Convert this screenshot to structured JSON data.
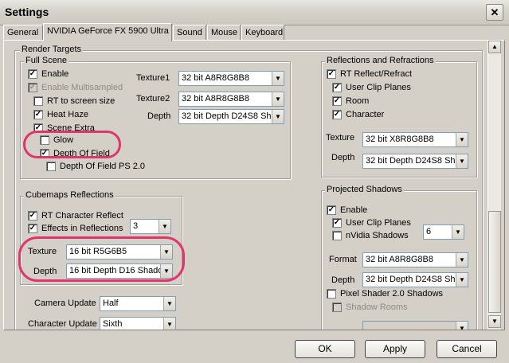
{
  "window": {
    "title": "Settings",
    "close_glyph": "✕"
  },
  "tabs": [
    "General",
    "NVIDIA GeForce FX 5900 Ultra",
    "Sound",
    "Mouse",
    "Keyboard"
  ],
  "render_targets": {
    "title": "Render Targets",
    "full_scene": {
      "title": "Full Scene",
      "checks": [
        {
          "label": "Enable",
          "checked": true,
          "enabled": true
        },
        {
          "label": "Enable Multisampled",
          "checked": true,
          "enabled": false
        },
        {
          "label": "RT to screen size",
          "checked": false,
          "enabled": true
        },
        {
          "label": "Heat Haze",
          "checked": true,
          "enabled": true
        },
        {
          "label": "Scene Extra",
          "checked": true,
          "enabled": true
        },
        {
          "label": "Glow",
          "checked": false,
          "enabled": true
        },
        {
          "label": "Depth Of Field",
          "checked": true,
          "enabled": true
        },
        {
          "label": "Depth Of Field PS 2.0",
          "checked": false,
          "enabled": true
        }
      ],
      "texture1_label": "Texture1",
      "texture1_value": "32 bit A8R8G8B8",
      "texture2_label": "Texture2",
      "texture2_value": "32 bit A8R8G8B8",
      "depth_label": "Depth",
      "depth_value": "32 bit Depth D24S8 Sh"
    },
    "reflections": {
      "title": "Reflections and Refractions",
      "checks": [
        {
          "label": "RT Reflect/Refract",
          "checked": true
        },
        {
          "label": "User Clip Planes",
          "checked": true
        },
        {
          "label": "Room",
          "checked": true
        },
        {
          "label": "Character",
          "checked": true
        }
      ],
      "texture_label": "Texture",
      "texture_value": "32 bit X8R8G8B8",
      "depth_label": "Depth",
      "depth_value": "32 bit Depth D24S8 Sh"
    },
    "cubemaps": {
      "title": "Cubemaps Reflections",
      "rt_character_reflect": "RT Character Reflect",
      "effects_in_reflections": "Effects in Reflections",
      "effects_count": "3",
      "texture_label": "Texture",
      "texture_value": "16 bit R5G6B5",
      "depth_label": "Depth",
      "depth_value": "16 bit Depth D16 Shado"
    },
    "camera_update_label": "Camera Update",
    "camera_update_value": "Half",
    "character_update_label": "Character Update",
    "character_update_value": "Sixth",
    "projected_shadows": {
      "title": "Projected Shadows",
      "enable": "Enable",
      "user_clip_planes": "User Clip Planes",
      "nvidia_shadows": "nVidia Shadows",
      "nvidia_count": "6",
      "format_label": "Format",
      "format_value": "32 bit A8R8G8B8",
      "depth_label": "Depth",
      "depth_value": "32 bit Depth D24S8 Sh",
      "pixel_shader_shadows": "Pixel Shader 2.0 Shadows",
      "shadow_rooms": "Shadow Rooms"
    }
  },
  "buttons": {
    "ok": "OK",
    "apply": "Apply",
    "cancel": "Cancel"
  },
  "colors": {
    "annotation": "#e0356a",
    "dialog_bg": "#d4d0c8"
  }
}
